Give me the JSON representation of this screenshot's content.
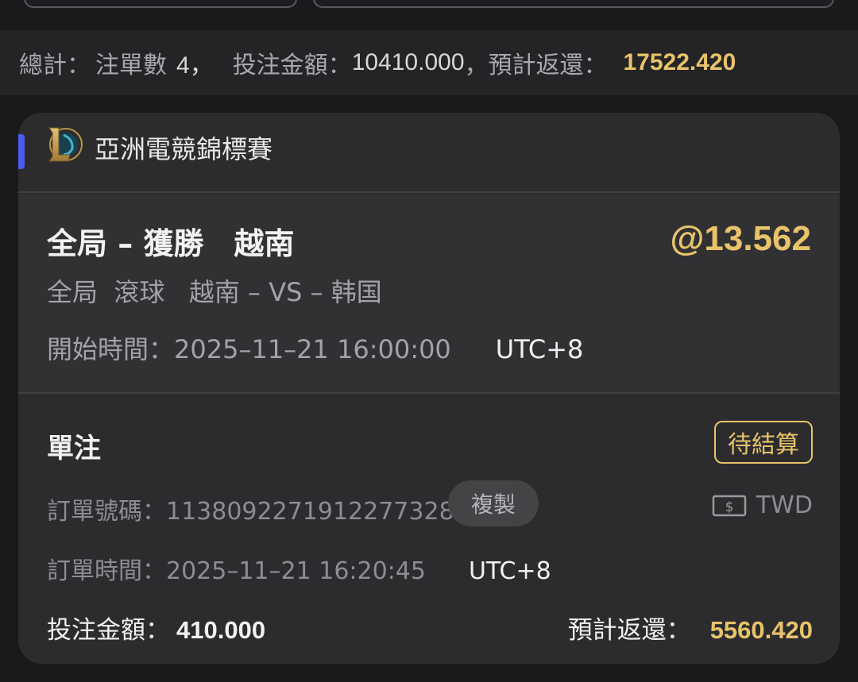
{
  "summary": {
    "label": "總計：",
    "count_label": "注單數",
    "count": "4，",
    "stake_label": "投注金額：",
    "stake": "10410.000",
    "sep": "，",
    "return_label": "預計返還：",
    "return_value": "17522.420"
  },
  "league": {
    "icon": "lol-icon",
    "name": "亞洲電競錦標賽"
  },
  "match": {
    "market": "全局 – 獲勝　越南",
    "odds": "@13.562",
    "description": "全局  滾球   越南 – VS – 韩国",
    "start_label": "開始時間：",
    "start_time": "2025–11–21 16:00:00",
    "start_tz": "UTC+8"
  },
  "bet": {
    "type": "單注",
    "status": "待結算",
    "order_no_label": "訂單號碼：",
    "order_no": "1138092271912277328",
    "copy_label": "複製",
    "currency_icon": "cash-icon",
    "currency": "TWD",
    "order_time_label": "訂單時間：",
    "order_time": "2025–11–21 16:20:45",
    "order_tz": "UTC+8",
    "stake_label": "投注金額：",
    "stake": "410.000",
    "return_label": "預計返還：",
    "return_value": "5560.420"
  },
  "colors": {
    "accent": "#4a5cf0",
    "gold": "#e8c36a",
    "card_bg": "#2c2c2e"
  }
}
